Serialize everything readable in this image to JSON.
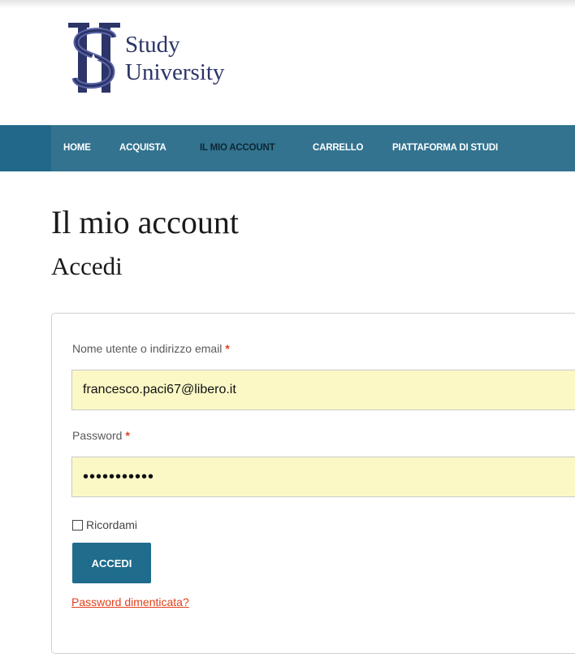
{
  "brand": {
    "line1": "Study",
    "line2": "University",
    "color": "#2c3468",
    "accent": "#5b66a8"
  },
  "nav": {
    "items": [
      {
        "label": "HOME"
      },
      {
        "label": "ACQUISTA"
      },
      {
        "label": "IL MIO ACCOUNT",
        "active": true
      },
      {
        "label": "CARRELLO"
      },
      {
        "label": "PIATTAFORMA DI STUDI"
      }
    ],
    "background": "#33738f"
  },
  "page": {
    "title": "Il mio account",
    "section_title": "Accedi"
  },
  "login_form": {
    "username_label": "Nome utente o indirizzo email",
    "required_mark": "*",
    "username_value": "francesco.paci67@libero.it",
    "password_label": "Password",
    "password_value": "•••••••••••",
    "remember_label": "Ricordami",
    "remember_checked": false,
    "submit_label": "ACCEDI",
    "lost_password_label": "Password dimenticata?",
    "input_background": "#fbf8c6",
    "button_color": "#1f6c8c",
    "link_color": "#e2401c"
  }
}
